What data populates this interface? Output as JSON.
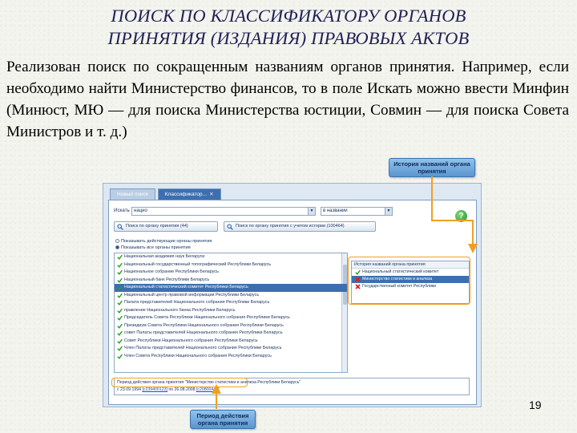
{
  "slide": {
    "title_line1": "ПОИСК ПО КЛАССИФИКАТОРУ ОРГАНОВ",
    "title_line2": "ПРИНЯТИЯ (ИЗДАНИЯ) ПРАВОВЫХ АКТОВ",
    "body": "Реализован поиск по сокращенным названиям органов принятия. Например, если необходимо найти Министерство финансов, то в поле Искать можно ввести Минфин (Минюст, МЮ — для поиска Министерства юстиции, Совмин — для поиска Совета Министров и т. д.)",
    "page_number": "19"
  },
  "app": {
    "tabs": [
      {
        "label": "Новый поиск",
        "active": false
      },
      {
        "label": "Классификатор...",
        "active": true
      }
    ],
    "search": {
      "label": "Искать",
      "value": "нацио",
      "mode_value": "в названии"
    },
    "buttons": {
      "search_by_organ": "Поиск по органу принятия (44)",
      "search_by_history": "Поиск по органу принятия с учетом истории (100464)"
    },
    "radios": [
      {
        "label": "Показывать действующие органы принятия",
        "checked": false
      },
      {
        "label": "Показывать все органы принятия",
        "checked": true
      }
    ],
    "organs": [
      {
        "name": "Национальная академия наук Беларуси",
        "selected": false
      },
      {
        "name": "Национальный государственный топографический Республики Беларусь",
        "selected": false
      },
      {
        "name": "Национальное собрание Республики Беларусь",
        "selected": false
      },
      {
        "name": "Национальный банк Республики Беларусь",
        "selected": false
      },
      {
        "name": "Национальный статистический комитет Республики Беларусь",
        "selected": true
      },
      {
        "name": "Национальный центр правовой информации Республики Беларусь",
        "selected": false
      },
      {
        "name": "Палата представителей Национального собрания Республики Беларусь",
        "selected": false
      },
      {
        "name": "правление Национального банка Республики Беларусь",
        "selected": false
      },
      {
        "name": "Председатель Совета Республики Национального собрания Республики Беларусь",
        "selected": false
      },
      {
        "name": "Президиум Совета Республики Национального собрания Республики Беларусь",
        "selected": false
      },
      {
        "name": "совет Палаты представителей Национального собрания Республики Беларусь",
        "selected": false
      },
      {
        "name": "Совет Республики Национального собрания Республики Беларусь",
        "selected": false
      },
      {
        "name": "Член Палаты представителей Национального собрания Республики Беларусь",
        "selected": false
      },
      {
        "name": "Член Совета Республики Национального собрания Республики Беларусь",
        "selected": false
      }
    ],
    "history": {
      "title": "История названий органа принятия",
      "items": [
        {
          "name": "Национальный статистический комитет",
          "mark": "check",
          "selected": false
        },
        {
          "name": "Министерство статистики и анализа",
          "mark": "cross",
          "selected": true
        },
        {
          "name": "Государственный комитет Республики",
          "mark": "cross",
          "selected": false
        }
      ]
    },
    "period": {
      "title": "Период действия органа принятия \"Министерство статистики и анализа Республики Беларусь\"",
      "from_date": "23.09.1994",
      "from_ref": "[с239400123]",
      "to_label": "по",
      "to_date": "26.08.2008",
      "to_ref": "[с20800446]",
      "prefix": "с"
    }
  },
  "callouts": {
    "history": "История названий органа принятия",
    "period": "Период действия органа принятия"
  },
  "colors": {
    "accent_orange": "#f0a020",
    "selection_blue": "#3d6fb0",
    "callout_blue": "#6aa4dc",
    "title_color": "#1f1f55"
  }
}
